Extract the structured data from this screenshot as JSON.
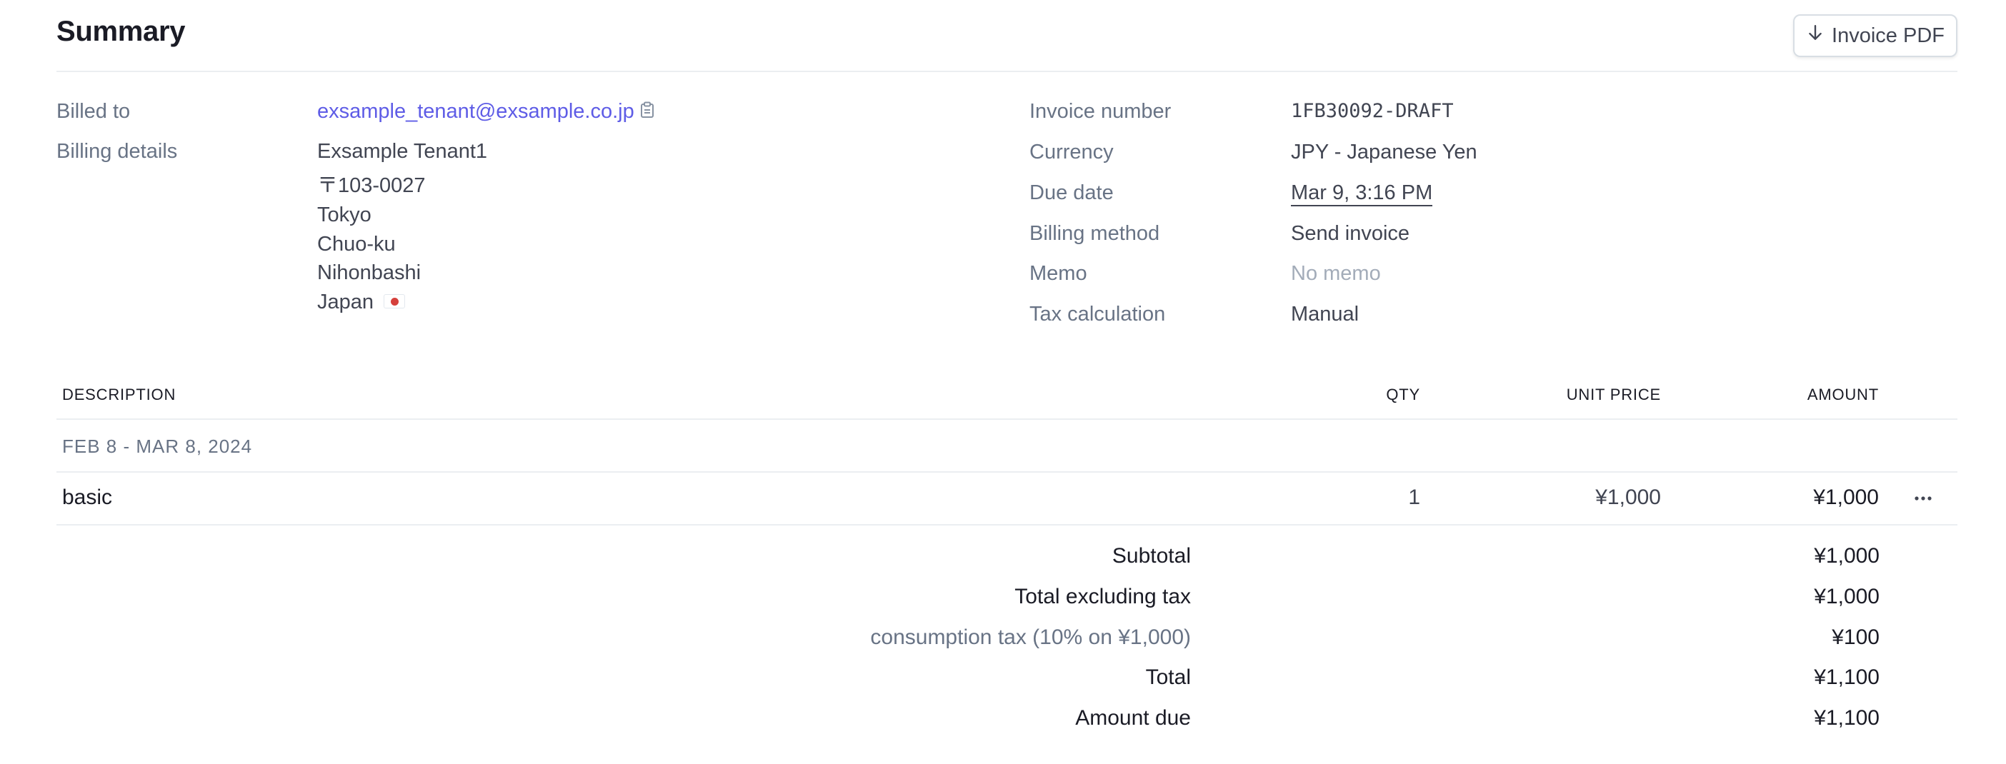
{
  "header": {
    "title": "Summary",
    "pdf_button_label": "Invoice PDF"
  },
  "billing": {
    "billed_to_label": "Billed to",
    "billed_to_email": "exsample_tenant@exsample.co.jp",
    "details_label": "Billing details",
    "details_lines": [
      "Exsample Tenant1",
      "〒103-0027",
      "Tokyo",
      "Chuo-ku",
      "Nihonbashi",
      "Japan"
    ]
  },
  "invoice": {
    "number_label": "Invoice number",
    "number_value": "1FB30092-DRAFT",
    "currency_label": "Currency",
    "currency_value": "JPY - Japanese Yen",
    "due_label": "Due date",
    "due_value": "Mar 9, 3:16 PM",
    "method_label": "Billing method",
    "method_value": "Send invoice",
    "memo_label": "Memo",
    "memo_value": "No memo",
    "tax_label": "Tax calculation",
    "tax_value": "Manual"
  },
  "table": {
    "columns": [
      "DESCRIPTION",
      "QTY",
      "UNIT PRICE",
      "AMOUNT"
    ],
    "period": "FEB 8 - MAR 8, 2024",
    "items": [
      {
        "description": "basic",
        "qty": "1",
        "unit_price": "¥1,000",
        "amount": "¥1,000"
      }
    ]
  },
  "totals": [
    {
      "label": "Subtotal",
      "value": "¥1,000"
    },
    {
      "label": "Total excluding tax",
      "value": "¥1,000"
    },
    {
      "label": "consumption tax (10% on ¥1,000)",
      "value": "¥100"
    },
    {
      "label": "Total",
      "value": "¥1,100"
    },
    {
      "label": "Amount due",
      "value": "¥1,100"
    }
  ],
  "icons": {
    "pdf_button": "arrow-down-icon",
    "copy": "clipboard-icon",
    "flag": "japan-flag-icon",
    "more": "more-horizontal-icon"
  },
  "colors": {
    "link": "#5e5ce6",
    "label": "#687385",
    "text": "#414552",
    "heading": "#1a1b25",
    "muted": "#a3acb9",
    "divider": "#ebeef1"
  }
}
